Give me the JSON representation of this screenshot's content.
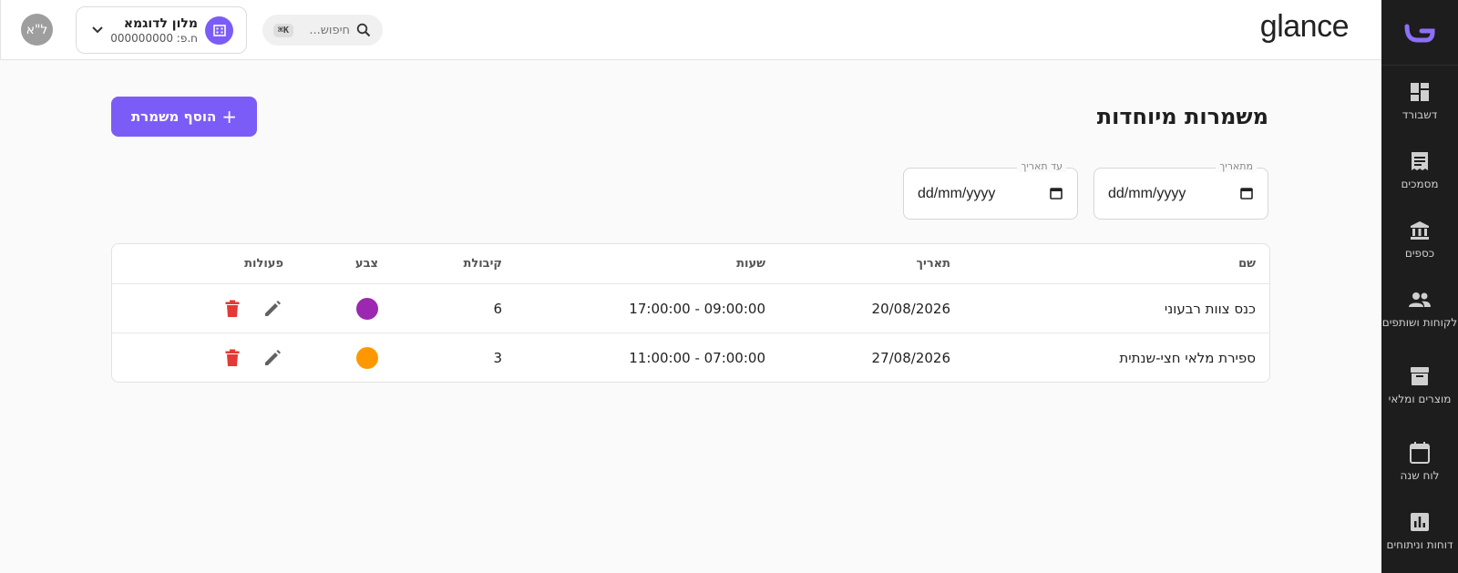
{
  "app": {
    "brand": "glance"
  },
  "user": {
    "initials": "ל\"א"
  },
  "hotel": {
    "name": "מלון לדוגמא",
    "id_label": "ח.פ: 000000000"
  },
  "search": {
    "placeholder": "חיפוש...",
    "shortcut": "⌘K"
  },
  "sidebar": {
    "items": [
      {
        "label": "דשבורד",
        "icon": "dashboard-icon"
      },
      {
        "label": "מסמכים",
        "icon": "receipt-icon"
      },
      {
        "label": "כספים",
        "icon": "bank-icon"
      },
      {
        "label": "לקוחות ושותפים",
        "icon": "people-icon"
      },
      {
        "label": "מוצרים ומלאי",
        "icon": "archive-icon"
      },
      {
        "label": "לוח שנה",
        "icon": "calendar-icon"
      },
      {
        "label": "דוחות וניתוחים",
        "icon": "chart-icon"
      }
    ]
  },
  "page": {
    "title": "משמרות מיוחדות",
    "add_button": "הוסף משמרת"
  },
  "filters": {
    "from": {
      "label": "מתאריך",
      "value": "dd/mm/yyyy"
    },
    "to": {
      "label": "עד תאריך",
      "value": "dd/mm/yyyy"
    }
  },
  "table": {
    "headers": {
      "name": "שם",
      "date": "תאריך",
      "hours": "שעות",
      "capacity": "קיבולת",
      "color": "צבע",
      "actions": "פעולות"
    },
    "rows": [
      {
        "name": "כנס צוות רבעוני",
        "date": "20/08/2026",
        "hours": "09:00:00 - 17:00:00",
        "capacity": "6",
        "color": "#9c27b0"
      },
      {
        "name": "ספירת מלאי חצי-שנתית",
        "date": "27/08/2026",
        "hours": "07:00:00 - 11:00:00",
        "capacity": "3",
        "color": "#ff9800"
      }
    ]
  },
  "colors": {
    "accent": "#7c5cf7",
    "sidebar_bg": "#1d1d1d",
    "delete": "#e53935",
    "edit": "#616161"
  }
}
